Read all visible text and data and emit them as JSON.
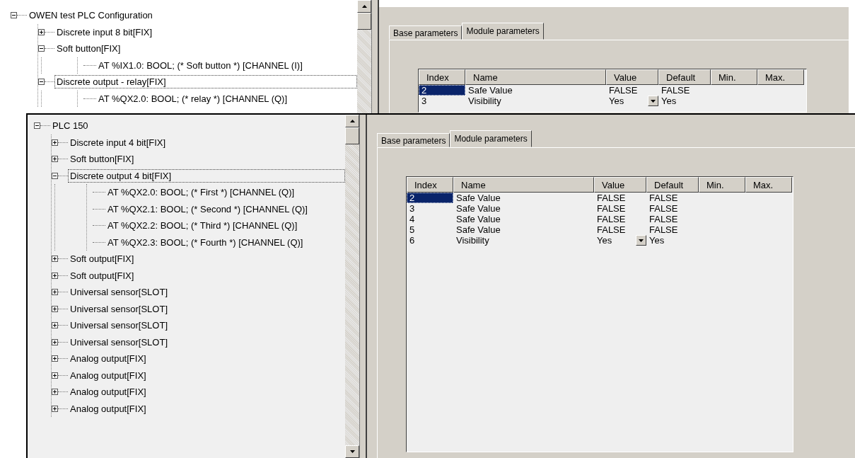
{
  "back_window": {
    "tree": {
      "label": "OWEN test PLC Configuration",
      "expanded": true,
      "children": [
        {
          "label": "Discrete input 8 bit[FIX]",
          "expanded": false,
          "selected": false
        },
        {
          "label": "Soft button[FIX]",
          "expanded": true,
          "selected": false,
          "children": [
            {
              "label": "AT %IX1.0: BOOL; (* Soft button *) [CHANNEL (I)]"
            }
          ]
        },
        {
          "label": "Discrete output - relay[FIX]",
          "expanded": true,
          "selected": true,
          "children": [
            {
              "label": "AT %QX2.0: BOOL; (* relay *) [CHANNEL (Q)]"
            }
          ]
        }
      ]
    },
    "tabs": [
      {
        "label": "Base parameters",
        "selected": false
      },
      {
        "label": "Module parameters",
        "selected": true
      }
    ],
    "table": {
      "columns": [
        "Index",
        "Name",
        "Value",
        "Default",
        "Min.",
        "Max."
      ],
      "rows": [
        {
          "index": "2",
          "name": "Safe Value",
          "value": "FALSE",
          "default": "FALSE",
          "kind": "text",
          "selected": true
        },
        {
          "index": "3",
          "name": "Visibility",
          "value": "Yes",
          "default": "Yes",
          "kind": "dropdown",
          "selected": false
        }
      ]
    }
  },
  "front_window": {
    "tree": {
      "label": "PLC 150",
      "expanded": true,
      "children": [
        {
          "label": "Discrete input 4 bit[FIX]",
          "expanded": false,
          "selected": false
        },
        {
          "label": "Soft button[FIX]",
          "expanded": false,
          "selected": false
        },
        {
          "label": "Discrete output 4 bit[FIX]",
          "expanded": true,
          "selected": true,
          "children": [
            {
              "label": "AT %QX2.0: BOOL; (* First *) [CHANNEL (Q)]"
            },
            {
              "label": "AT %QX2.1: BOOL; (* Second *) [CHANNEL (Q)]"
            },
            {
              "label": "AT %QX2.2: BOOL; (* Third *) [CHANNEL (Q)]"
            },
            {
              "label": "AT %QX2.3: BOOL; (* Fourth *) [CHANNEL (Q)]"
            }
          ]
        },
        {
          "label": "Soft output[FIX]",
          "expanded": false,
          "selected": false
        },
        {
          "label": "Soft output[FIX]",
          "expanded": false,
          "selected": false
        },
        {
          "label": "Universal sensor[SLOT]",
          "expanded": false,
          "selected": false
        },
        {
          "label": "Universal sensor[SLOT]",
          "expanded": false,
          "selected": false
        },
        {
          "label": "Universal sensor[SLOT]",
          "expanded": false,
          "selected": false
        },
        {
          "label": "Universal sensor[SLOT]",
          "expanded": false,
          "selected": false
        },
        {
          "label": "Analog output[FIX]",
          "expanded": false,
          "selected": false
        },
        {
          "label": "Analog output[FIX]",
          "expanded": false,
          "selected": false
        },
        {
          "label": "Analog output[FIX]",
          "expanded": false,
          "selected": false
        },
        {
          "label": "Analog output[FIX]",
          "expanded": false,
          "selected": false
        }
      ]
    },
    "tabs": [
      {
        "label": "Base parameters",
        "selected": false
      },
      {
        "label": "Module parameters",
        "selected": true
      }
    ],
    "table": {
      "columns": [
        "Index",
        "Name",
        "Value",
        "Default",
        "Min.",
        "Max."
      ],
      "rows": [
        {
          "index": "2",
          "name": "Safe Value",
          "value": "FALSE",
          "default": "FALSE",
          "kind": "text",
          "selected": true
        },
        {
          "index": "3",
          "name": "Safe Value",
          "value": "FALSE",
          "default": "FALSE",
          "kind": "text",
          "selected": false
        },
        {
          "index": "4",
          "name": "Safe Value",
          "value": "FALSE",
          "default": "FALSE",
          "kind": "text",
          "selected": false
        },
        {
          "index": "5",
          "name": "Safe Value",
          "value": "FALSE",
          "default": "FALSE",
          "kind": "text",
          "selected": false
        },
        {
          "index": "6",
          "name": "Visibility",
          "value": "Yes",
          "default": "Yes",
          "kind": "dropdown",
          "selected": false
        }
      ]
    }
  }
}
